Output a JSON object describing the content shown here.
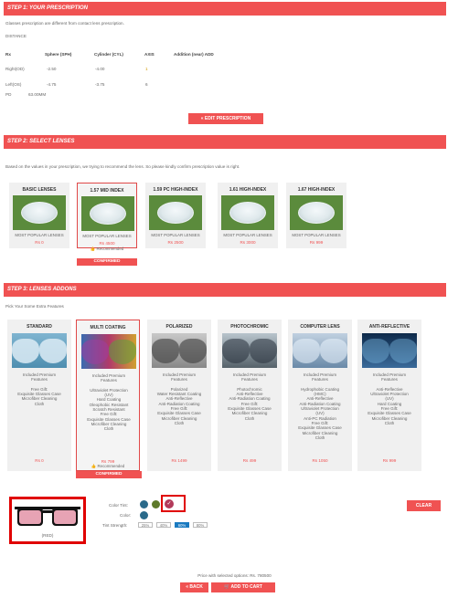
{
  "step1": {
    "title": "STEP 1: YOUR PRESCRIPTION",
    "note": "Glasses prescription are different from contact lens prescription.",
    "distance_label": "DISTANCE",
    "headers": [
      "Rx",
      "Sphere (SPH)",
      "Cylinder (CYL)",
      "AXIS",
      "Addition (near) ADD"
    ],
    "rows": [
      {
        "rx": "Right(OD)",
        "sph": "-2.50",
        "cyl": "-4.00",
        "axis": "1",
        "add": ""
      },
      {
        "rx": "Left(OS)",
        "sph": "-4.75",
        "cyl": "-3.75",
        "axis": "6",
        "add": ""
      }
    ],
    "pd_label": "PD",
    "pd_value": "63.00MM",
    "edit_button": "« EDIT PRESCRIPTION"
  },
  "step2": {
    "title": "STEP 2: SELECT LENSES",
    "note": "Based on the values in your prescription, we trying to recommend the lens. So please kindly confirm prescription value is right.",
    "lenses": [
      {
        "title": "BASIC LENSES",
        "tag": "MOST POPULAR LENSES",
        "price": "Rs 0",
        "selected": false
      },
      {
        "title": "1.57 MID INDEX",
        "tag": "MOST POPULAR LENSES",
        "price": "Rs 4500",
        "recommended": "👍 Recommended",
        "selected": true
      },
      {
        "title": "1.59 PC HIGH-INDEX",
        "tag": "MOST POPULAR LENSES",
        "price": "Rs 2500",
        "selected": false
      },
      {
        "title": "1.61 HIGH-INDEX",
        "tag": "MOST POPULAR LENSES",
        "price": "Rs 3000",
        "selected": false
      },
      {
        "title": "1.67 HIGH-INDEX",
        "tag": "MOST POPULAR LENSES",
        "price": "Rs 999",
        "selected": false
      }
    ],
    "confirmed": "CONFIRMED"
  },
  "step3": {
    "title": "STEP 3: LENSES ADDONS",
    "note": "Pick Your Some Extra Features",
    "addons": [
      {
        "title": "STANDARD",
        "desc": [
          "Included Premium",
          "Features",
          "",
          "Free Gift:",
          "Exquisite Glasses Case",
          "Microfiber Cleaning",
          "Cloth"
        ],
        "price": "Rs 0",
        "selected": false
      },
      {
        "title": "MULTI COATING",
        "desc": [
          "Included Premium",
          "Features",
          "",
          "Ultraviolet Protection",
          "(UV)",
          "Hard Coating",
          "Oleophobic Resistant",
          "Scratch Resistant",
          "Free Gift:",
          "Exquisite Glasses Case",
          "Microfiber Cleaning",
          "Cloth"
        ],
        "price": "Rs 799",
        "recommended": "👍 Recommended",
        "selected": true
      },
      {
        "title": "POLARIZED",
        "desc": [
          "Included Premium",
          "Features",
          "",
          "Polarized",
          "Water Resistant Coating",
          "Anti-Reflective",
          "Anti-Radiation Coating",
          "Free Gift:",
          "Exquisite Glasses Case",
          "Microfiber Cleaning",
          "Cloth"
        ],
        "price": "Rs 1499",
        "selected": false
      },
      {
        "title": "PHOTOCHROMIC",
        "desc": [
          "Included Premium",
          "Features",
          "",
          "Photochromic",
          "Anti-Reflective",
          "Anti-Radiation Coating",
          "Free Gift:",
          "Exquisite Glasses Case",
          "Microfiber Cleaning",
          "Cloth"
        ],
        "price": "Rs 499",
        "selected": false
      },
      {
        "title": "COMPUTER LENS",
        "desc": [
          "Included Premium",
          "Features",
          "",
          "Hydrophobic Coating",
          "(HMC)",
          "Anti-Reflective",
          "Anti-Radiation Coating",
          "Ultraviolet Protection",
          "(UV)",
          "Anti-PC Radiation",
          "Free Gift:",
          "Exquisite Glasses Case",
          "Microfiber Cleaning",
          "Cloth"
        ],
        "price": "Rs 1050",
        "selected": false
      },
      {
        "title": "ANTI-REFLECTIVE",
        "desc": [
          "Included Premium",
          "Features",
          "",
          "Anti-Reflective",
          "Ultraviolet Protection",
          "(UV)",
          "Hard Coating",
          "Free Gift:",
          "Exquisite Glasses Case",
          "Microfiber Cleaning",
          "Cloth"
        ],
        "price": "Rs 999",
        "selected": false
      }
    ],
    "confirmed": "CONFIRMED"
  },
  "tint": {
    "preview_label": "(RED)",
    "color_tint_label": "Color Tint:",
    "color_label": "Color:",
    "strength_label": "Tint Strength:",
    "strengths": [
      "25%",
      "40%",
      "60%",
      "80%"
    ],
    "selected_strength": "60%",
    "clear_button": "CLEAR",
    "colors": {
      "blue": "#2a6a8a",
      "green": "#5e7a2a",
      "red": "#b23a5a",
      "selected_border": "#e00000"
    }
  },
  "footer": {
    "price_text": "Price with selected options: Rs. 780500",
    "back_button": "« BACK",
    "add_button": "🛒 ADD TO CART"
  },
  "accent": "#f05252"
}
